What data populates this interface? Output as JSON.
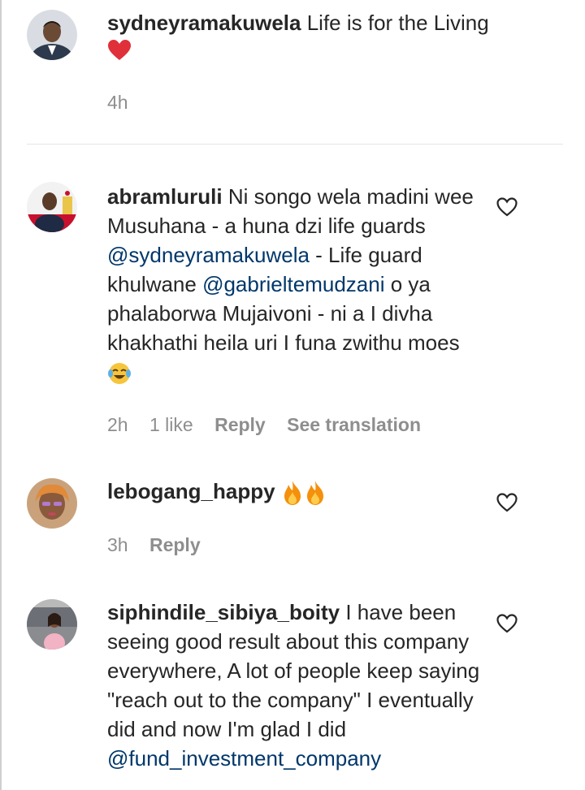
{
  "comments": [
    {
      "username": "sydneyramakuwela",
      "text": "Life is for the Living",
      "emoji": "red-heart",
      "time": "4h"
    },
    {
      "username": "abramluruli",
      "text_parts": {
        "p1": "Ni songo wela madini wee Musuhana - a huna dzi life guards ",
        "mention1": "@sydneyramakuwela",
        "p2": " - Life guard khulwane ",
        "mention2": "@gabrieltemudzani",
        "p3": " o ya phalaborwa Mujaivoni - ni a I divha khakhathi heila uri I funa zwithu moes "
      },
      "emoji": "face-with-tears-of-joy",
      "time": "2h",
      "likes": "1 like",
      "reply": "Reply",
      "see_translation": "See translation"
    },
    {
      "username": "lebogang_happy",
      "emoji": "fire x2",
      "time": "3h",
      "reply": "Reply"
    },
    {
      "username": "siphindile_sibiya_boity",
      "text": "I have been seeing good result about this company everywhere, A lot of people keep saying \"reach out to the company\" I eventually did and now I'm glad I did",
      "mention": "@fund_investment_company"
    }
  ],
  "colors": {
    "text": "#262626",
    "secondary": "#8e8e8e",
    "mention": "#00376b",
    "heart": "#ed4956"
  }
}
